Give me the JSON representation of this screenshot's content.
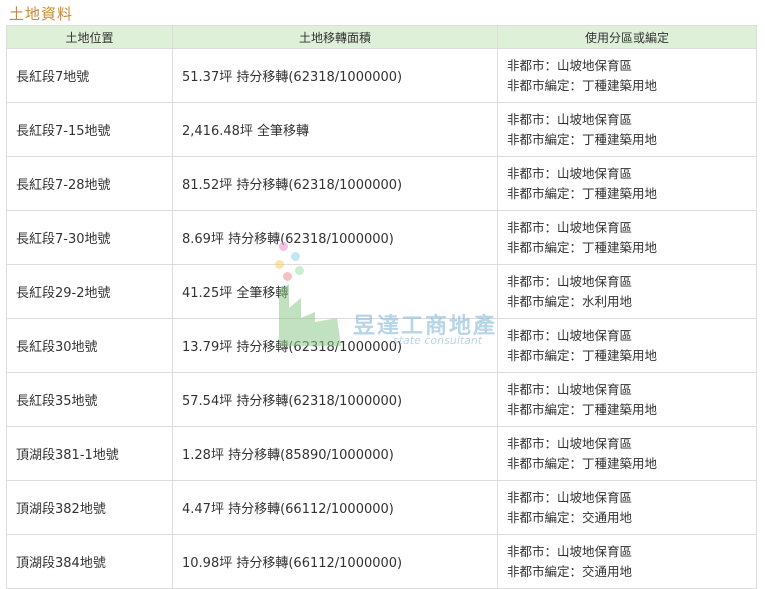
{
  "section_title": "土地資料",
  "columns": [
    "土地位置",
    "土地移轉面積",
    "使用分區或編定"
  ],
  "rows": [
    {
      "location": "長紅段7地號",
      "area": "51.37坪 持分移轉(62318/1000000)",
      "zone1": "非都市：山坡地保育區",
      "zone2": "非都市編定：丁種建築用地"
    },
    {
      "location": "長紅段7-15地號",
      "area": "2,416.48坪 全筆移轉",
      "zone1": "非都市：山坡地保育區",
      "zone2": "非都市編定：丁種建築用地"
    },
    {
      "location": "長紅段7-28地號",
      "area": "81.52坪 持分移轉(62318/1000000)",
      "zone1": "非都市：山坡地保育區",
      "zone2": "非都市編定：丁種建築用地"
    },
    {
      "location": "長紅段7-30地號",
      "area": "8.69坪 持分移轉(62318/1000000)",
      "zone1": "非都市：山坡地保育區",
      "zone2": "非都市編定：丁種建築用地"
    },
    {
      "location": "長紅段29-2地號",
      "area": "41.25坪 全筆移轉",
      "zone1": "非都市：山坡地保育區",
      "zone2": "非都市編定：水利用地"
    },
    {
      "location": "長紅段30地號",
      "area": "13.79坪 持分移轉(62318/1000000)",
      "zone1": "非都市：山坡地保育區",
      "zone2": "非都市編定：丁種建築用地"
    },
    {
      "location": "長紅段35地號",
      "area": "57.54坪 持分移轉(62318/1000000)",
      "zone1": "非都市：山坡地保育區",
      "zone2": "非都市編定：丁種建築用地"
    },
    {
      "location": "頂湖段381-1地號",
      "area": "1.28坪 持分移轉(85890/1000000)",
      "zone1": "非都市：山坡地保育區",
      "zone2": "非都市編定：丁種建築用地"
    },
    {
      "location": "頂湖段382地號",
      "area": "4.47坪 持分移轉(66112/1000000)",
      "zone1": "非都市：山坡地保育區",
      "zone2": "非都市編定：交通用地"
    },
    {
      "location": "頂湖段384地號",
      "area": "10.98坪 持分移轉(66112/1000000)",
      "zone1": "非都市：山坡地保育區",
      "zone2": "非都市編定：交通用地"
    }
  ],
  "watermark": {
    "name": "昱達工商地產",
    "sub": "state consultant"
  },
  "colors": {
    "title": "#c98a2e",
    "header_bg": "#dff0d8",
    "border": "#dddddd"
  }
}
